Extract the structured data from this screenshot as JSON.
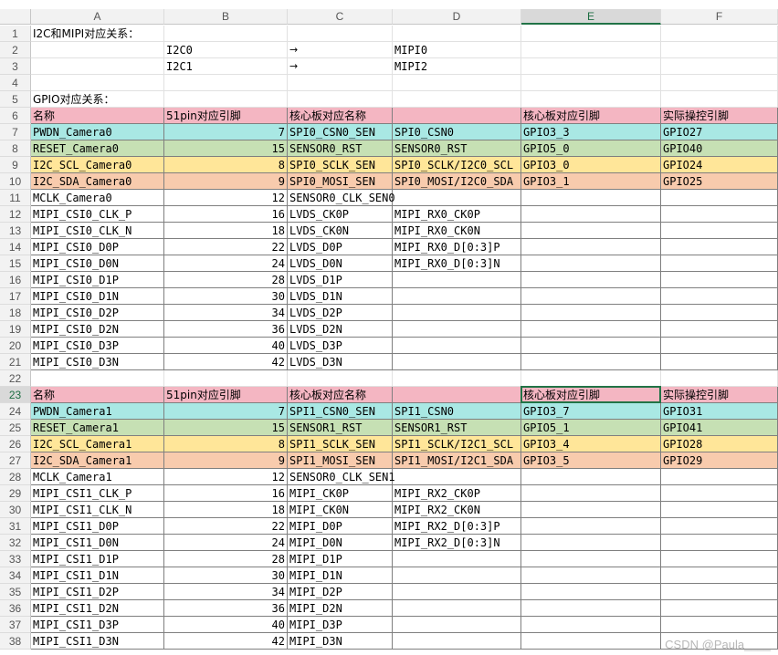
{
  "columns": [
    "A",
    "B",
    "C",
    "D",
    "E",
    "F"
  ],
  "selected_column": "E",
  "selected_row": 23,
  "colors": {
    "pink": "#f4b6c2",
    "cyan": "#a9e8e4",
    "green": "#c6e0b4",
    "yellow": "#ffe699",
    "orange": "#f8cbad",
    "select_border": "#217346"
  },
  "rows": [
    {
      "n": 1,
      "A": "I2C和MIPI对应关系："
    },
    {
      "n": 2,
      "B": "I2C0",
      "C": "→",
      "D": "MIPI0"
    },
    {
      "n": 3,
      "B": "I2C1",
      "C": "→",
      "D": "MIPI2"
    },
    {
      "n": 4
    },
    {
      "n": 5,
      "A": "GPIO对应关系："
    },
    {
      "n": 6,
      "fill": "pink",
      "A": "名称",
      "B": "51pin对应引脚",
      "C": "核心板对应名称",
      "E": "核心板对应引脚",
      "F": "实际操控引脚"
    },
    {
      "n": 7,
      "fill": "cyan",
      "A": "PWDN_Camera0",
      "B": "7",
      "C": "SPI0_CSN0_SEN",
      "D": "SPI0_CSN0",
      "E": "GPIO3_3",
      "F": "GPIO27"
    },
    {
      "n": 8,
      "fill": "green",
      "A": "RESET_Camera0",
      "B": "15",
      "C": "SENSOR0_RST",
      "D": "SENSOR0_RST",
      "E": "GPIO5_0",
      "F": "GPIO40"
    },
    {
      "n": 9,
      "fill": "yellow",
      "A": "I2C_SCL_Camera0",
      "B": "8",
      "C": "SPI0_SCLK_SEN",
      "D": "SPI0_SCLK/I2C0_SCL",
      "E": "GPIO3_0",
      "F": "GPIO24"
    },
    {
      "n": 10,
      "fill": "orange",
      "A": "I2C_SDA_Camera0",
      "B": "9",
      "C": "SPI0_MOSI_SEN",
      "D": "SPI0_MOSI/I2C0_SDA",
      "E": "GPIO3_1",
      "F": "GPIO25"
    },
    {
      "n": 11,
      "A": "MCLK_Camera0",
      "B": "12",
      "C": "SENSOR0_CLK_SEN0"
    },
    {
      "n": 12,
      "A": "MIPI_CSI0_CLK_P",
      "B": "16",
      "C": "LVDS_CK0P",
      "D": "MIPI_RX0_CK0P"
    },
    {
      "n": 13,
      "A": "MIPI_CSI0_CLK_N",
      "B": "18",
      "C": "LVDS_CK0N",
      "D": "MIPI_RX0_CK0N"
    },
    {
      "n": 14,
      "A": "MIPI_CSI0_D0P",
      "B": "22",
      "C": "LVDS_D0P",
      "D": "MIPI_RX0_D[0:3]P"
    },
    {
      "n": 15,
      "A": "MIPI_CSI0_D0N",
      "B": "24",
      "C": "LVDS_D0N",
      "D": "MIPI_RX0_D[0:3]N"
    },
    {
      "n": 16,
      "A": "MIPI_CSI0_D1P",
      "B": "28",
      "C": "LVDS_D1P"
    },
    {
      "n": 17,
      "A": "MIPI_CSI0_D1N",
      "B": "30",
      "C": "LVDS_D1N"
    },
    {
      "n": 18,
      "A": "MIPI_CSI0_D2P",
      "B": "34",
      "C": "LVDS_D2P"
    },
    {
      "n": 19,
      "A": "MIPI_CSI0_D2N",
      "B": "36",
      "C": "LVDS_D2N"
    },
    {
      "n": 20,
      "A": "MIPI_CSI0_D3P",
      "B": "40",
      "C": "LVDS_D3P"
    },
    {
      "n": 21,
      "A": "MIPI_CSI0_D3N",
      "B": "42",
      "C": "LVDS_D3N"
    },
    {
      "n": 22
    },
    {
      "n": 23,
      "fill": "pink",
      "A": "名称",
      "B": "51pin对应引脚",
      "C": "核心板对应名称",
      "E": "核心板对应引脚",
      "F": "实际操控引脚"
    },
    {
      "n": 24,
      "fill": "cyan",
      "A": "PWDN_Camera1",
      "B": "7",
      "C": "SPI1_CSN0_SEN",
      "D": "SPI1_CSN0",
      "E": "GPIO3_7",
      "F": "GPIO31"
    },
    {
      "n": 25,
      "fill": "green",
      "A": "RESET_Camera1",
      "B": "15",
      "C": "SENSOR1_RST",
      "D": "SENSOR1_RST",
      "E": "GPIO5_1",
      "F": "GPIO41"
    },
    {
      "n": 26,
      "fill": "yellow",
      "A": "I2C_SCL_Camera1",
      "B": "8",
      "C": "SPI1_SCLK_SEN",
      "D": "SPI1_SCLK/I2C1_SCL",
      "E": "GPIO3_4",
      "F": "GPIO28"
    },
    {
      "n": 27,
      "fill": "orange",
      "A": "I2C_SDA_Camera1",
      "B": "9",
      "C": "SPI1_MOSI_SEN",
      "D": "SPI1_MOSI/I2C1_SDA",
      "E": "GPIO3_5",
      "F": "GPIO29"
    },
    {
      "n": 28,
      "A": "MCLK_Camera1",
      "B": "12",
      "C": "SENSOR0_CLK_SEN1"
    },
    {
      "n": 29,
      "A": "MIPI_CSI1_CLK_P",
      "B": "16",
      "C": "MIPI_CK0P",
      "D": "MIPI_RX2_CK0P"
    },
    {
      "n": 30,
      "A": "MIPI_CSI1_CLK_N",
      "B": "18",
      "C": "MIPI_CK0N",
      "D": "MIPI_RX2_CK0N"
    },
    {
      "n": 31,
      "A": "MIPI_CSI1_D0P",
      "B": "22",
      "C": "MIPI_D0P",
      "D": "MIPI_RX2_D[0:3]P"
    },
    {
      "n": 32,
      "A": "MIPI_CSI1_D0N",
      "B": "24",
      "C": "MIPI_D0N",
      "D": "MIPI_RX2_D[0:3]N"
    },
    {
      "n": 33,
      "A": "MIPI_CSI1_D1P",
      "B": "28",
      "C": "MIPI_D1P"
    },
    {
      "n": 34,
      "A": "MIPI_CSI1_D1N",
      "B": "30",
      "C": "MIPI_D1N"
    },
    {
      "n": 35,
      "A": "MIPI_CSI1_D2P",
      "B": "34",
      "C": "MIPI_D2P"
    },
    {
      "n": 36,
      "A": "MIPI_CSI1_D2N",
      "B": "36",
      "C": "MIPI_D2N"
    },
    {
      "n": 37,
      "A": "MIPI_CSI1_D3P",
      "B": "40",
      "C": "MIPI_D3P"
    },
    {
      "n": 38,
      "A": "MIPI_CSI1_D3N",
      "B": "42",
      "C": "MIPI_D3N"
    }
  ],
  "watermark": "CSDN @Paula____"
}
